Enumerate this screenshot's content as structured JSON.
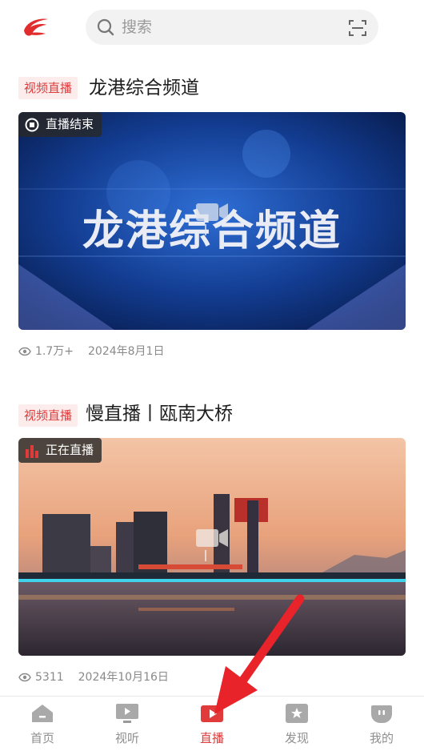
{
  "header": {
    "logo_icon": "red-swirl-logo-icon",
    "search_placeholder": "搜索",
    "scan_icon": "scan-icon"
  },
  "feed": [
    {
      "tag": "视频直播",
      "title": "龙港综合频道",
      "status": "直播结束",
      "status_icon": "stop-icon",
      "thumbnail_text": "龙港综合频道",
      "views": "1.7万+",
      "date": "2024年8月1日"
    },
    {
      "tag": "视频直播",
      "title": "慢直播丨瓯南大桥",
      "status": "正在直播",
      "status_icon": "live-bars-icon",
      "views": "5311",
      "date": "2024年10月16日"
    }
  ],
  "bottom_nav": {
    "items": [
      {
        "label": "首页",
        "icon": "home-icon"
      },
      {
        "label": "视听",
        "icon": "tv-icon"
      },
      {
        "label": "直播",
        "icon": "live-play-icon",
        "active": true
      },
      {
        "label": "发现",
        "icon": "discover-star-icon"
      },
      {
        "label": "我的",
        "icon": "profile-face-icon"
      }
    ]
  },
  "colors": {
    "accent": "#e13a3a",
    "tag_bg": "#fdecec",
    "nav_inactive": "#8f8f8f"
  }
}
